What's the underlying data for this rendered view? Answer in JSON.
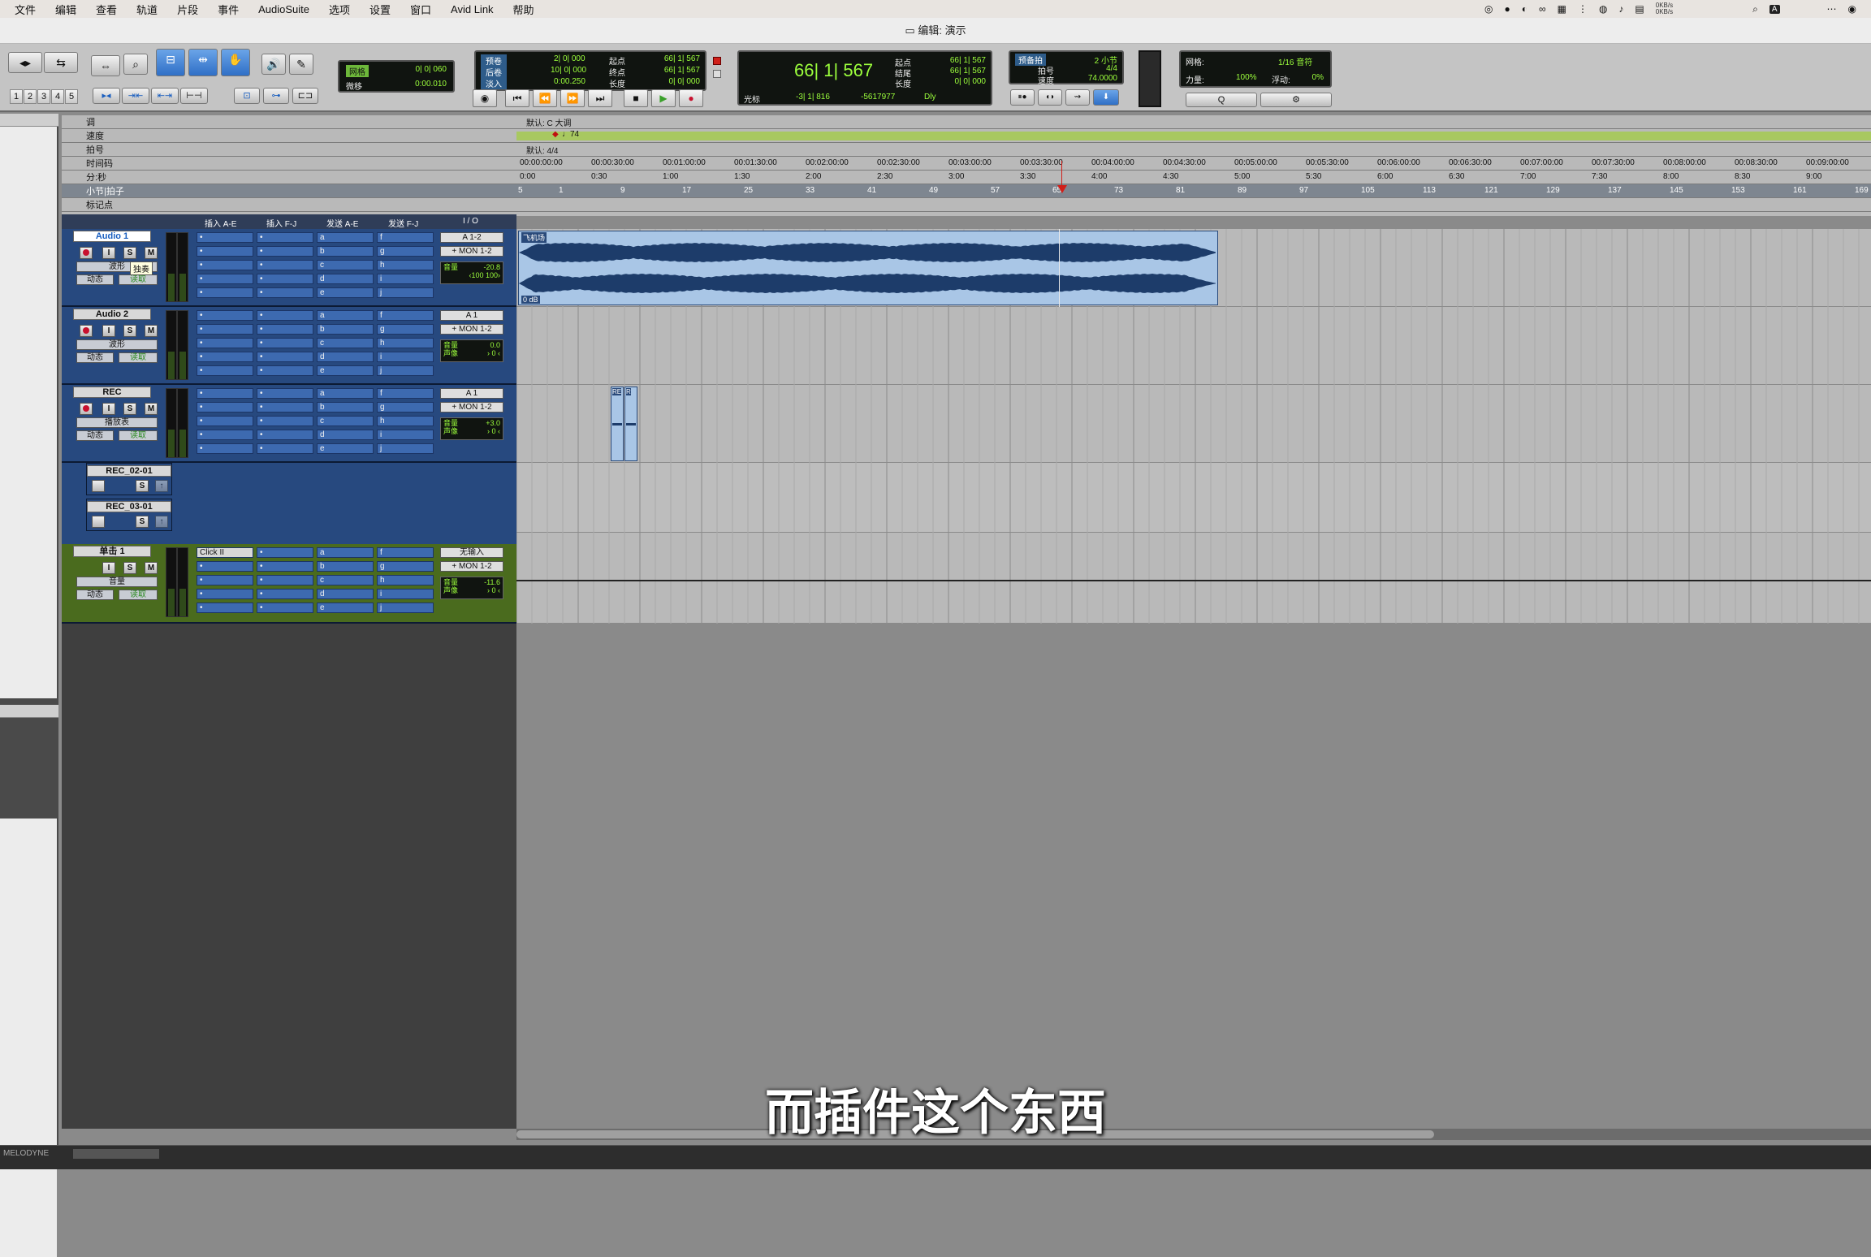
{
  "menubar": {
    "items": [
      "文件",
      "编辑",
      "查看",
      "轨道",
      "片段",
      "事件",
      "AudioSuite",
      "选项",
      "设置",
      "窗口",
      "Avid Link",
      "帮助"
    ],
    "net_up": "0KB/s",
    "net_down": "0KB/s"
  },
  "window": {
    "title": "编辑: 演示"
  },
  "toolbar": {
    "track_numbers": [
      "1",
      "2",
      "3",
      "4",
      "5"
    ],
    "grid_nudge": {
      "grid_label": "网格",
      "grid_value": "0| 0| 060",
      "nudge_label": "微移",
      "nudge_value": "0:00.010"
    },
    "preroll": {
      "rows": [
        {
          "label": "预卷",
          "value": "2| 0| 000"
        },
        {
          "label": "后卷",
          "value": "10| 0| 000"
        },
        {
          "label": "淡入",
          "value": "0:00.250"
        }
      ],
      "rows2": [
        {
          "label": "起点",
          "value": "66| 1| 567"
        },
        {
          "label": "终点",
          "value": "66| 1| 567"
        },
        {
          "label": "长度",
          "value": "0| 0| 000"
        }
      ]
    },
    "counter": {
      "main": "66| 1| 567",
      "cursor_label": "光标",
      "cursor_value": "-3| 1| 816",
      "cursor_sample": "-5617977",
      "rows": [
        {
          "label": "起点",
          "value": "66| 1| 567"
        },
        {
          "label": "结尾",
          "value": "66| 1| 567"
        },
        {
          "label": "长度",
          "value": "0| 0| 000"
        }
      ],
      "dly": "Dly"
    },
    "tempo": {
      "countoff": "预备拍",
      "bars": "2 小节",
      "meter_label": "拍号",
      "meter": "4/4",
      "tempo_label": "速度",
      "tempo": "74.0000"
    },
    "grid_panel": {
      "grid_label": "网格:",
      "grid_value": "1/16 音符",
      "strength_label": "力量:",
      "strength": "100%",
      "swing_label": "浮动:",
      "swing": "0%"
    }
  },
  "rulers": {
    "labels": [
      "调",
      "速度",
      "拍号",
      "时间码",
      "分:秒",
      "小节|拍子",
      "标记点"
    ],
    "key_text": "默认: C 大调",
    "tempo_text": "♩74",
    "meter_text": "默认: 4/4",
    "timecode": [
      "00:00:00:00",
      "00:00:30:00",
      "00:01:00:00",
      "00:01:30:00",
      "00:02:00:00",
      "00:02:30:00",
      "00:03:00:00",
      "00:03:30:00",
      "00:04:00:00",
      "00:04:30:00",
      "00:05:00:00",
      "00:05:30:00",
      "00:06:00:00",
      "00:06:30:00",
      "00:07:00:00",
      "00:07:30:00",
      "00:08:00:00",
      "00:08:30:00",
      "00:09:00:00"
    ],
    "minsec": [
      "0:00",
      "0:30",
      "1:00",
      "1:30",
      "2:00",
      "2:30",
      "3:00",
      "3:30",
      "4:00",
      "4:30",
      "5:00",
      "5:30",
      "6:00",
      "6:30",
      "7:00",
      "7:30",
      "8:00",
      "8:30",
      "9:00"
    ],
    "bars": [
      "5",
      "1",
      "9",
      "17",
      "25",
      "33",
      "41",
      "49",
      "57",
      "65",
      "73",
      "81",
      "89",
      "97",
      "105",
      "113",
      "121",
      "129",
      "137",
      "145",
      "153",
      "161",
      "169"
    ]
  },
  "columns": [
    "插入 A-E",
    "插入 F-J",
    "发送 A-E",
    "发送 F-J",
    "I / O"
  ],
  "send_letters_ae": [
    "a",
    "b",
    "c",
    "d",
    "e"
  ],
  "send_letters_fj": [
    "f",
    "g",
    "h",
    "i",
    "j"
  ],
  "tracks": [
    {
      "name": "Audio 1",
      "view": "波形",
      "auto": "动态",
      "mode": "读取",
      "io1": "A 1-2",
      "io2": "+ MON 1-2",
      "vol_label": "音量",
      "vol": "-20.8",
      "pan": "‹100  100›",
      "tooltip": "独奏"
    },
    {
      "name": "Audio 2",
      "view": "波形",
      "auto": "动态",
      "mode": "读取",
      "io1": "A 1",
      "io2": "+ MON 1-2",
      "vol_label": "音量",
      "vol": "0.0",
      "pan_label": "声像",
      "pan": "› 0 ‹"
    },
    {
      "name": "REC",
      "view": "播放表",
      "auto": "动态",
      "mode": "读取",
      "io1": "A 1",
      "io2": "+ MON 1-2",
      "vol_label": "音量",
      "vol": "+3.0",
      "pan_label": "声像",
      "pan": "› 0 ‹"
    },
    {
      "name": "单击 1",
      "view": "音量",
      "auto": "动态",
      "mode": "读取",
      "insert": "Click II",
      "io1": "无输入",
      "io2": "+ MON 1-2",
      "vol_label": "音量",
      "vol": "-11.6",
      "pan_label": "声像",
      "pan": "› 0 ‹"
    }
  ],
  "playlists": [
    {
      "name": "REC_02-01",
      "solo": "S"
    },
    {
      "name": "REC_03-01",
      "solo": "S"
    }
  ],
  "clips": {
    "audio1": {
      "name": "飞机场",
      "gain": "0 dB"
    },
    "rec_a": "RE",
    "rec_b": "R"
  },
  "subtitle": "而插件这个东西",
  "status": {
    "plugin_tab": "MELODYNE"
  }
}
